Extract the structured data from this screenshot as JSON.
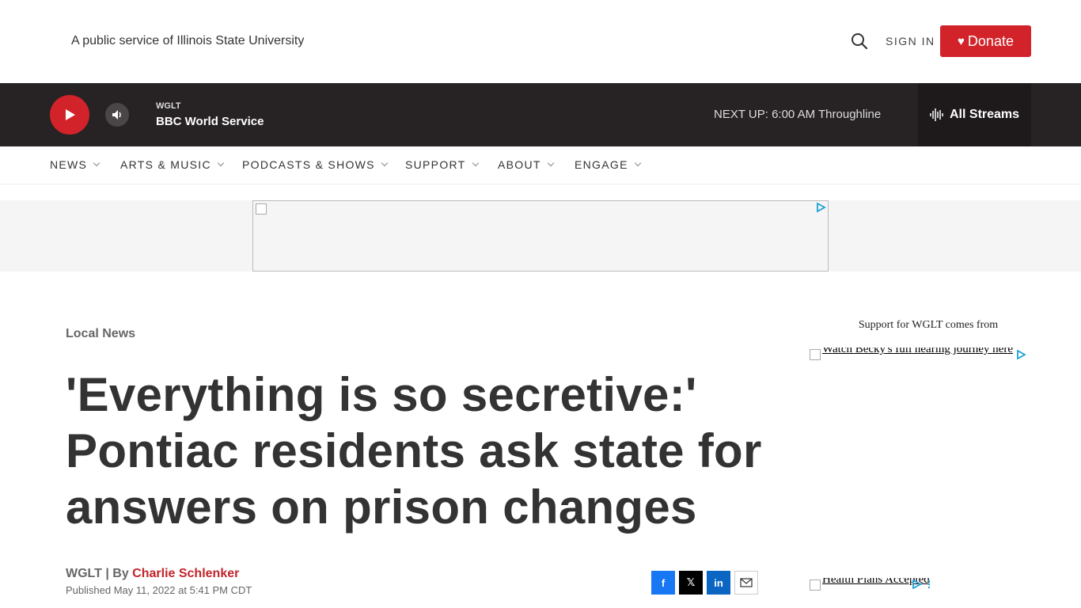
{
  "header": {
    "tagline": "A public service of Illinois State University",
    "sign_in": "SIGN IN",
    "donate": "Donate"
  },
  "player": {
    "station_label": "WGLT",
    "station_name": "BBC World Service",
    "next_up": "NEXT UP: 6:00 AM Throughline",
    "all_streams": "All Streams"
  },
  "nav": {
    "items": [
      "NEWS",
      "ARTS & MUSIC",
      "PODCASTS & SHOWS",
      "SUPPORT",
      "ABOUT",
      "ENGAGE"
    ]
  },
  "article": {
    "section": "Local News",
    "headline": "'Everything is so secretive:' Pontiac residents ask state for answers on prison changes",
    "byline_prefix": "WGLT | By ",
    "author": "Charlie Schlenker",
    "published": "Published May 11, 2022 at 5:41 PM CDT"
  },
  "share": {
    "facebook": "f",
    "x": "𝕏",
    "linkedin": "in"
  },
  "sidebar": {
    "sponsor_label": "Support for WGLT comes from",
    "ad1_alt": "Watch Becky's full hearing journey here",
    "ad2_alt": "Health Plans Accepted"
  },
  "colors": {
    "brand_red": "#d2232a",
    "player_bg": "#272223",
    "author_red": "#c3232a"
  },
  "icons": [
    "search-icon",
    "heart-icon",
    "play-icon",
    "volume-icon",
    "waveform-icon",
    "chevron-down-icon",
    "adchoices-icon",
    "facebook-icon",
    "x-icon",
    "linkedin-icon",
    "email-icon"
  ]
}
